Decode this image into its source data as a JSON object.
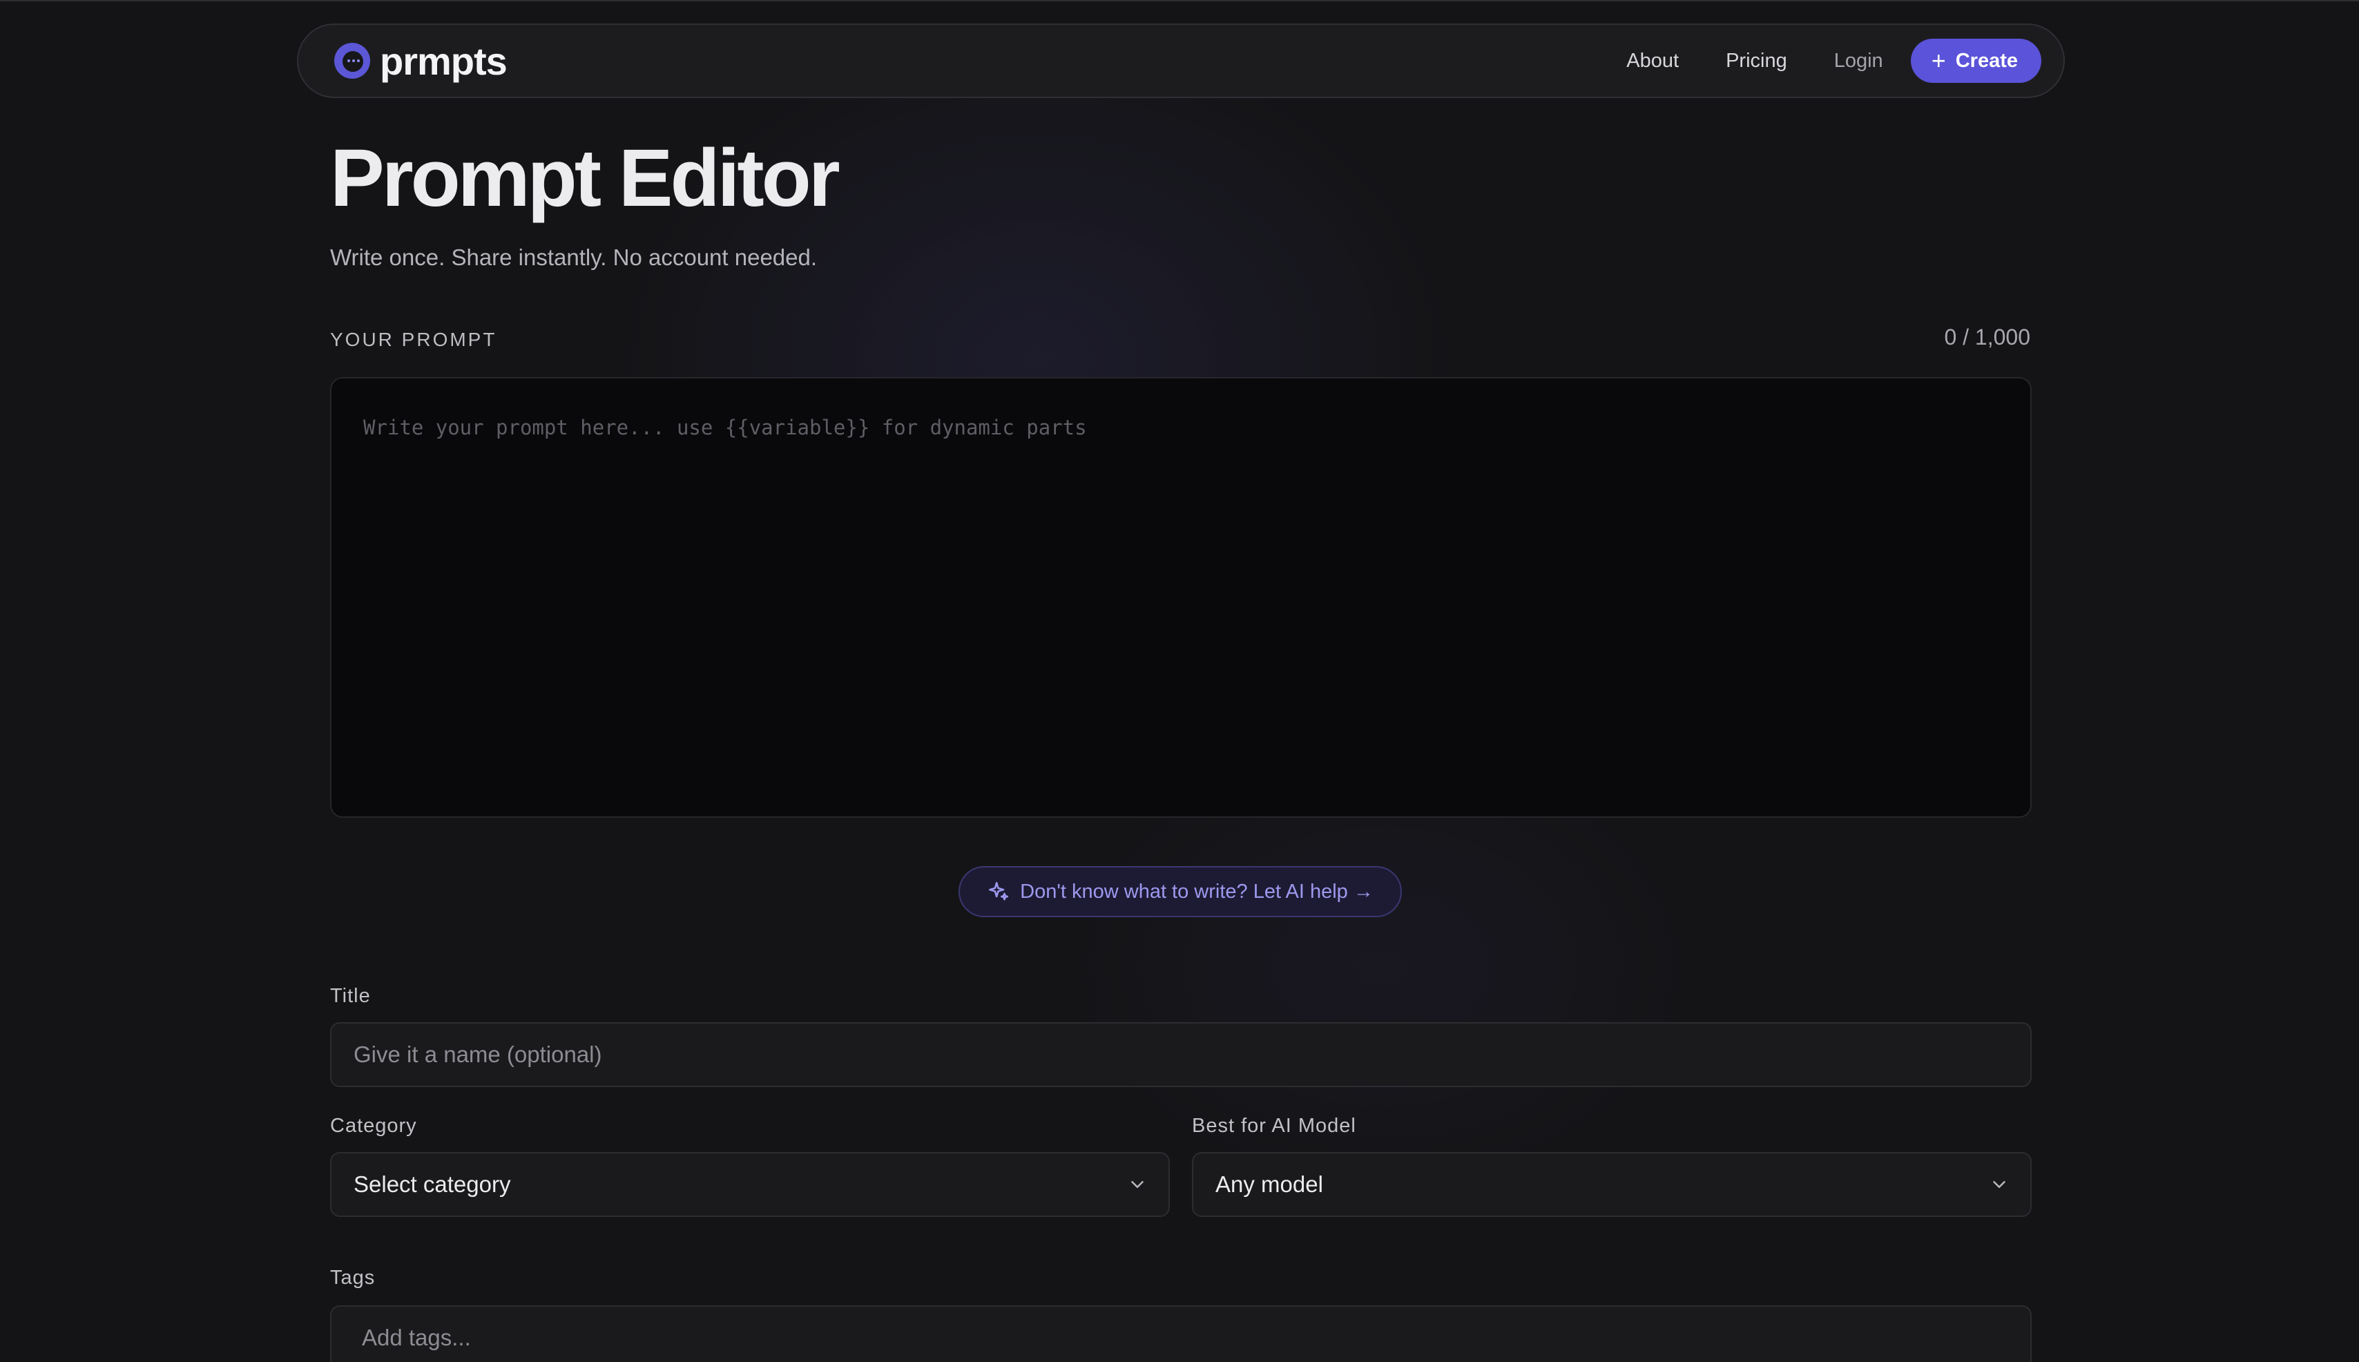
{
  "brand": {
    "name": "prmpts"
  },
  "nav": {
    "about": "About",
    "pricing": "Pricing",
    "login": "Login",
    "create": "Create"
  },
  "header": {
    "title": "Prompt Editor",
    "subtitle": "Write once. Share instantly. No account needed."
  },
  "prompt": {
    "label": "YOUR PROMPT",
    "counter": "0 / 1,000",
    "placeholder": "Write your prompt here... use {{variable}} for dynamic parts",
    "ai_help": "Don't know what to write? Let AI help →"
  },
  "form": {
    "title_label": "Title",
    "title_placeholder": "Give it a name (optional)",
    "category_label": "Category",
    "category_value": "Select category",
    "model_label": "Best for AI Model",
    "model_value": "Any model",
    "tags_label": "Tags",
    "tags_placeholder": "Add tags..."
  },
  "colors": {
    "accent": "#5b53d9",
    "background": "#141416"
  }
}
